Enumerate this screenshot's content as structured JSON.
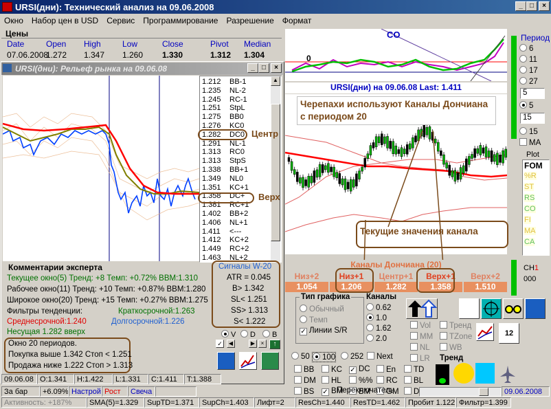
{
  "window": {
    "title": "URSI(дни): Технический анализ на 09.06.2008"
  },
  "menu": [
    "Окно",
    "Набор цен в USD",
    "Сервис",
    "Программирование",
    "Разрешение",
    "Формат"
  ],
  "prices": {
    "section_title": "Цены",
    "headers": [
      "Date",
      "Open",
      "High",
      "Low",
      "Close",
      "Pivot",
      "Median"
    ],
    "values": [
      "07.06.2008",
      "1.272",
      "1.347",
      "1.260",
      "1.330",
      "1.312",
      "1.304"
    ]
  },
  "relief_window": {
    "title": "URSI(дни): Рельеф рынка на 09.06.08"
  },
  "levels": [
    {
      "value": "1.212",
      "label": "BB-1"
    },
    {
      "value": "1.235",
      "label": "NL-2"
    },
    {
      "value": "1.245",
      "label": "RC-1"
    },
    {
      "value": "1.251",
      "label": "StpL"
    },
    {
      "value": "1.275",
      "label": "BB0"
    },
    {
      "value": "1.276",
      "label": "KC0"
    },
    {
      "value": "1.282",
      "label": "DC0"
    },
    {
      "value": "1.291",
      "label": "NL-1"
    },
    {
      "value": "1.313",
      "label": "RC0"
    },
    {
      "value": "1.313",
      "label": "StpS"
    },
    {
      "value": "1.338",
      "label": "BB+1"
    },
    {
      "value": "1.349",
      "label": "NL0"
    },
    {
      "value": "1.351",
      "label": "KC+1"
    },
    {
      "value": "1.358",
      "label": "DC+"
    },
    {
      "value": "1.381",
      "label": "RC+1"
    },
    {
      "value": "1.402",
      "label": "BB+2"
    },
    {
      "value": "1.406",
      "label": "NL+1"
    },
    {
      "value": "1.411",
      "label": "<---"
    },
    {
      "value": "1.412",
      "label": "KC+2"
    },
    {
      "value": "1.449",
      "label": "RC+2"
    },
    {
      "value": "1.463",
      "label": "NL+2"
    }
  ],
  "annotations": {
    "center": "Центр",
    "top": "Верх",
    "turtles": "Черепахи используют Каналы Дончиана с периодом 20",
    "current": "Текущие значения канала"
  },
  "co_chart": {
    "title": "CO",
    "zero_label": "0"
  },
  "main_chart": {
    "title": "URSI(дни) на 09.06.08",
    "last_label": "Last: 1.411"
  },
  "period": {
    "title": "Период",
    "options": [
      "6",
      "11",
      "17",
      "27",
      "5",
      "15"
    ],
    "selected": "5",
    "input1": "5",
    "input2": "15",
    "ma_label": "MA"
  },
  "plot_panel": {
    "title": "Plot",
    "header": "FOM",
    "items": [
      "%R",
      "ST",
      "RS",
      "CO",
      "FI",
      "MA",
      "CA"
    ],
    "ch_label": "CH",
    "ch_value": "1",
    "counter": "000"
  },
  "donchian": {
    "title": "Каналы Дончиана (20)",
    "headers": [
      "Низ+2",
      "Низ+1",
      "Центр+1",
      "Верх+1",
      "Верх+2"
    ],
    "values": [
      "1.054",
      "1.206",
      "1.282",
      "1.358",
      "1.510"
    ]
  },
  "expert": {
    "title": "Комментарии эксперта",
    "line1": "Текущее окно(5) Тренд: +8 Темп: +0.72% BBM:1.310",
    "line2": "Рабочее окно(11) Тренд: +10 Темп: +0.87% BBM:1.280",
    "line3": "Широкое окно(20) Тренд: +15 Темп: +0.27% BBM:1.275",
    "filters_label": "Фильтры тенденции:",
    "short_label": "Краткосрочной:1.263",
    "medium_label": "Среднесрочной:1.240",
    "long_label": "Долгосрочной:1.226",
    "carrier_label": "Несущая 1.282",
    "carrier_dir": "вверх",
    "box1": "Окно 20 периодов.",
    "box2": "Покупка выше 1.342  Стоп < 1.251",
    "box3": "Продажа ниже 1.222  Стоп > 1.313"
  },
  "signals": {
    "title": "Сигналы W-20",
    "atr": "ATR = 0.045",
    "b": "B> 1.342",
    "sl": "SL< 1.251",
    "ss": "SS> 1.313",
    "s": "S< 1.222"
  },
  "vdb": [
    "V",
    "D",
    "B"
  ],
  "chart_type": {
    "title": "Тип графика",
    "options": [
      "Обычный",
      "Темп"
    ],
    "lines_label": "Линии S/R",
    "channels_title": "Каналы",
    "channels": [
      "0.62",
      "1.0",
      "1.62",
      "2.0"
    ],
    "channels_selected": "1.0"
  },
  "checks": {
    "col1": [
      "Vol",
      "MM",
      "NL",
      "LR"
    ],
    "col2": [
      "Тренд",
      "TZone",
      "WB"
    ],
    "trend_label": "Тренд"
  },
  "bars": {
    "options": [
      "50",
      "100",
      "252"
    ],
    "selected": "100",
    "next": "Next"
  },
  "indicators": {
    "row1": [
      "BB",
      "KC",
      "DC",
      "En",
      "TD"
    ],
    "row2": [
      "DM",
      "HL",
      "%%",
      "RC",
      "BL"
    ],
    "row3": [
      "BS",
      "BM",
      "BM",
      "GM",
      "DN"
    ],
    "switch_label": "Переключатель",
    "checked": [
      "DC",
      "BM"
    ]
  },
  "status_row1": [
    "09.06.08",
    "O:1.341",
    "H:1.422",
    "L:1.331",
    "C:1.411",
    "T:1.388"
  ],
  "status_row2": {
    "za_bar": "За бар",
    "za_bar_val": "+6.09%",
    "nastroy": "Настрой",
    "rost": "Рост",
    "svecha": "Свеча",
    "date": "09.06.2008"
  },
  "status_row3": [
    "Активность: +187%",
    "SMA(5)=1.329",
    "SupTD=1.371",
    "SupCh=1.403",
    "Лифт=2",
    "ResCh=1.440",
    "ResTD=1.462",
    "Пробит 1.122",
    "Фильтр=1.399"
  ],
  "chart_data": [
    {
      "type": "line",
      "title": "",
      "series": [],
      "note_levels": {
        "center": 1.282,
        "top": 1.358
      }
    }
  ]
}
